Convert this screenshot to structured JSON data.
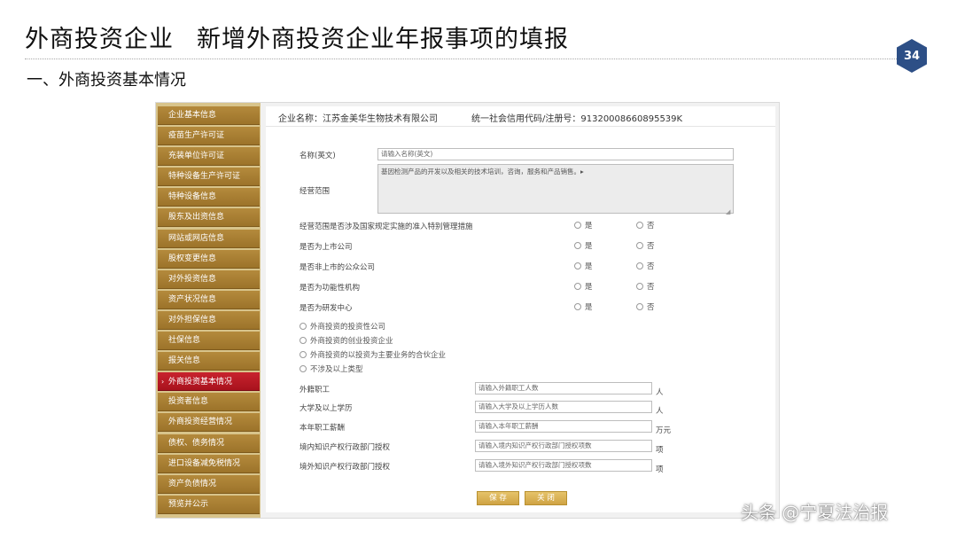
{
  "slide": {
    "title_part1": "外商投资企业",
    "title_part2": "新增外商投资企业年报事项的填报",
    "page_number": "34",
    "section": "一、外商投资基本情况",
    "watermark": "头条 @宁夏法治报"
  },
  "sidebar": {
    "active_index": 13,
    "items": [
      "企业基本信息",
      "疫苗生产许可证",
      "充装单位许可证",
      "特种设备生产许可证",
      "特种设备信息",
      "股东及出资信息",
      "网站或网店信息",
      "股权变更信息",
      "对外投资信息",
      "资产状况信息",
      "对外担保信息",
      "社保信息",
      "报关信息",
      "外商投资基本情况",
      "投资者信息",
      "外商投资经营情况",
      "债权、债务情况",
      "进口设备减免税情况",
      "资产负债情况",
      "预览并公示"
    ]
  },
  "company": {
    "name_label": "企业名称：江苏金美华生物技术有限公司",
    "credit_label": "统一社会信用代码/注册号：91320008660895539K"
  },
  "form": {
    "english_name_label": "名称(英文)",
    "english_name_placeholder": "请输入名称(英文)",
    "business_scope_label": "经营范围",
    "business_scope_value": "基因检测产品的开发以及相关的技术培训，咨询，服务和产品销售。▸",
    "yes": "是",
    "no": "否",
    "questions": [
      "经营范围是否涉及国家规定实施的准入特别管理措施",
      "是否为上市公司",
      "是否非上市的公众公司",
      "是否为功能性机构",
      "是否为研发中心"
    ],
    "type_options": [
      "外商投资的投资性公司",
      "外商投资的创业投资企业",
      "外商投资的以投资为主要业务的合伙企业",
      "不涉及以上类型"
    ],
    "number_fields": [
      {
        "label": "外籍职工",
        "placeholder": "请输入外籍职工人数",
        "unit": "人"
      },
      {
        "label": "大学及以上学历",
        "placeholder": "请输入大学及以上学历人数",
        "unit": "人"
      },
      {
        "label": "本年职工薪酬",
        "placeholder": "请输入本年职工薪酬",
        "unit": "万元"
      },
      {
        "label": "境内知识产权行政部门授权",
        "placeholder": "请输入境内知识产权行政部门授权项数",
        "unit": "项"
      },
      {
        "label": "境外知识产权行政部门授权",
        "placeholder": "请输入境外知识产权行政部门授权项数",
        "unit": "项"
      }
    ],
    "save_button": "保 存",
    "close_button": "关 闭"
  }
}
